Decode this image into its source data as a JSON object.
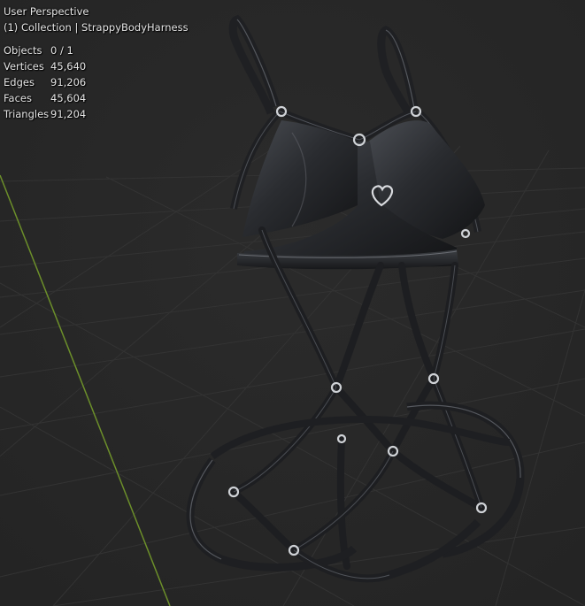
{
  "viewport": {
    "perspective_label": "User Perspective",
    "collection_label": "(1) Collection | StrappyBodyHarness"
  },
  "stats": [
    {
      "label": "Objects",
      "value": "0 / 1"
    },
    {
      "label": "Vertices",
      "value": "45,640"
    },
    {
      "label": "Edges",
      "value": "91,206"
    },
    {
      "label": "Faces",
      "value": "45,604"
    },
    {
      "label": "Triangles",
      "value": "91,204"
    }
  ],
  "colors": {
    "background": "#282828",
    "grid": "#333333",
    "y_axis": "#6c8f2a",
    "model": "#1c1d20",
    "highlight": "#6a6d73",
    "metal": "#cfd2d6"
  }
}
